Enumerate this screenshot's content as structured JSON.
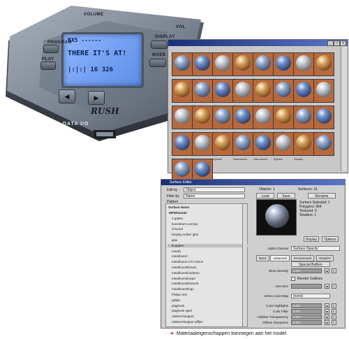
{
  "device": {
    "lcd": {
      "line1": "RX5 ------",
      "line2": "THERE IT'S AT!",
      "line3": "|:|:| 16 326"
    },
    "labels": {
      "program": "PROGRAM",
      "play": "PLAY",
      "display": "DISPLAY",
      "mode": "MODE EQ",
      "brand": "RUSH",
      "data_io": "DATA I/O",
      "top": "VOLUME",
      "vol": "VOL"
    },
    "arrow_left": "◀",
    "arrow_right": "▶"
  },
  "browser": {
    "swatch_labels": [
      "",
      "Metal",
      "Aluminum",
      "Silver",
      "Brass",
      "Bronze",
      "Gold",
      "",
      "",
      "Blue",
      "Chrome",
      "Glass",
      "Gold",
      "Copper",
      "Silver",
      "",
      "",
      "Chrome",
      "Pot",
      "Gloss",
      "Gold_Rip",
      "Gold_Rip",
      "Silver",
      "Shading",
      "Brushed_Chr",
      "Hammered",
      "Splotch",
      "Hammered",
      "Hammered",
      "Splotch",
      "Splotch",
      "",
      "Brushed_Chr",
      "Test"
    ],
    "window_buttons": [
      "_",
      "□",
      "x"
    ]
  },
  "editor": {
    "title": "Surface Editor",
    "edit_by_label": "Edit by",
    "edit_by_value": "Object",
    "filter_by_label": "Filter by",
    "filter_by_value": "Name",
    "pattern_label": "Pattern",
    "objects_label": "Objects: 1",
    "surfaces_label": "Surfaces: 21",
    "buttons": {
      "load": "Load",
      "save": "Save",
      "rename": "Rename",
      "display": "Display",
      "options": "Options"
    },
    "info": [
      "Surface Selected: 1",
      "Polygons: 964",
      "Textured: 0",
      "Shaders: 1"
    ],
    "tree_header": "Surface Name",
    "tree_items": [
      "MP3Remote",
      "4 gatten",
      "bovenkant vorm(ar",
      "chocard",
      "Display achter glas",
      "glas",
      "knoppen",
      "metal1",
      "metalhoest",
      "metalhoest 4 hr HOLD",
      "metalhoest/boven",
      "metalhoest/onderen",
      "metalhoest/zwart",
      "metalhoest/frame/a",
      "metalhoest/logo",
      "Philips tree",
      "pijltjes",
      "plaghoek",
      "plaghoek spiel",
      "rubbere/stopper",
      "rubbere/stopper plffjes"
    ],
    "highlighted_index": 6,
    "tabs": [
      "Basic",
      "Advanced",
      "Environment",
      "Shaders"
    ],
    "active_tab": 1,
    "props": {
      "alpha_channel_label": "Alpha Channel",
      "alpha_channel_value": "Surface Opacity",
      "special_buffers": "Special Buffers",
      "glow_intensity": "Glow Intensity",
      "render_outlines": "Render Outlines",
      "line_size": "Line Size",
      "vertex_color_map": "Vertex Color Map",
      "vertex_color_map_value": "(none)",
      "color_highlights": "Color Highlights",
      "color_filter": "Color Filter",
      "additive_transparency": "Additive Transparency",
      "diffuse_sharpness": "Diffuse Sharpness",
      "pct": "0.0%"
    }
  },
  "caption": {
    "arrow": "➜",
    "text": "Materiaaleigenschappen toevoegen aan het model."
  },
  "colors": {
    "title_bar": "#1b2f7a",
    "swatch_bg": "#b7693d",
    "caption_arrow": "#d4381e"
  }
}
